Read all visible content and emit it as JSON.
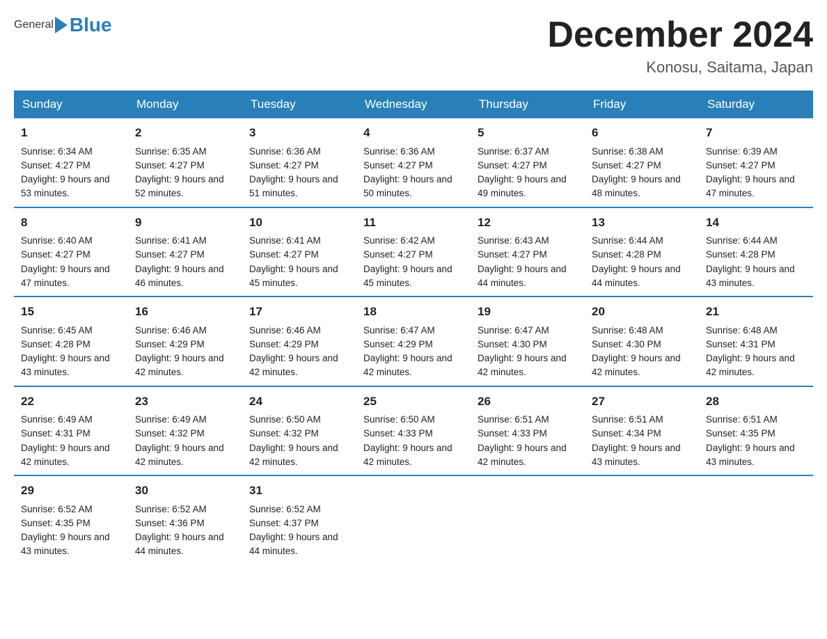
{
  "header": {
    "logo_general": "General",
    "logo_blue": "Blue",
    "month_title": "December 2024",
    "location": "Konosu, Saitama, Japan"
  },
  "days_of_week": [
    "Sunday",
    "Monday",
    "Tuesday",
    "Wednesday",
    "Thursday",
    "Friday",
    "Saturday"
  ],
  "weeks": [
    [
      {
        "day": "1",
        "sunrise": "6:34 AM",
        "sunset": "4:27 PM",
        "daylight": "9 hours and 53 minutes."
      },
      {
        "day": "2",
        "sunrise": "6:35 AM",
        "sunset": "4:27 PM",
        "daylight": "9 hours and 52 minutes."
      },
      {
        "day": "3",
        "sunrise": "6:36 AM",
        "sunset": "4:27 PM",
        "daylight": "9 hours and 51 minutes."
      },
      {
        "day": "4",
        "sunrise": "6:36 AM",
        "sunset": "4:27 PM",
        "daylight": "9 hours and 50 minutes."
      },
      {
        "day": "5",
        "sunrise": "6:37 AM",
        "sunset": "4:27 PM",
        "daylight": "9 hours and 49 minutes."
      },
      {
        "day": "6",
        "sunrise": "6:38 AM",
        "sunset": "4:27 PM",
        "daylight": "9 hours and 48 minutes."
      },
      {
        "day": "7",
        "sunrise": "6:39 AM",
        "sunset": "4:27 PM",
        "daylight": "9 hours and 47 minutes."
      }
    ],
    [
      {
        "day": "8",
        "sunrise": "6:40 AM",
        "sunset": "4:27 PM",
        "daylight": "9 hours and 47 minutes."
      },
      {
        "day": "9",
        "sunrise": "6:41 AM",
        "sunset": "4:27 PM",
        "daylight": "9 hours and 46 minutes."
      },
      {
        "day": "10",
        "sunrise": "6:41 AM",
        "sunset": "4:27 PM",
        "daylight": "9 hours and 45 minutes."
      },
      {
        "day": "11",
        "sunrise": "6:42 AM",
        "sunset": "4:27 PM",
        "daylight": "9 hours and 45 minutes."
      },
      {
        "day": "12",
        "sunrise": "6:43 AM",
        "sunset": "4:27 PM",
        "daylight": "9 hours and 44 minutes."
      },
      {
        "day": "13",
        "sunrise": "6:44 AM",
        "sunset": "4:28 PM",
        "daylight": "9 hours and 44 minutes."
      },
      {
        "day": "14",
        "sunrise": "6:44 AM",
        "sunset": "4:28 PM",
        "daylight": "9 hours and 43 minutes."
      }
    ],
    [
      {
        "day": "15",
        "sunrise": "6:45 AM",
        "sunset": "4:28 PM",
        "daylight": "9 hours and 43 minutes."
      },
      {
        "day": "16",
        "sunrise": "6:46 AM",
        "sunset": "4:29 PM",
        "daylight": "9 hours and 42 minutes."
      },
      {
        "day": "17",
        "sunrise": "6:46 AM",
        "sunset": "4:29 PM",
        "daylight": "9 hours and 42 minutes."
      },
      {
        "day": "18",
        "sunrise": "6:47 AM",
        "sunset": "4:29 PM",
        "daylight": "9 hours and 42 minutes."
      },
      {
        "day": "19",
        "sunrise": "6:47 AM",
        "sunset": "4:30 PM",
        "daylight": "9 hours and 42 minutes."
      },
      {
        "day": "20",
        "sunrise": "6:48 AM",
        "sunset": "4:30 PM",
        "daylight": "9 hours and 42 minutes."
      },
      {
        "day": "21",
        "sunrise": "6:48 AM",
        "sunset": "4:31 PM",
        "daylight": "9 hours and 42 minutes."
      }
    ],
    [
      {
        "day": "22",
        "sunrise": "6:49 AM",
        "sunset": "4:31 PM",
        "daylight": "9 hours and 42 minutes."
      },
      {
        "day": "23",
        "sunrise": "6:49 AM",
        "sunset": "4:32 PM",
        "daylight": "9 hours and 42 minutes."
      },
      {
        "day": "24",
        "sunrise": "6:50 AM",
        "sunset": "4:32 PM",
        "daylight": "9 hours and 42 minutes."
      },
      {
        "day": "25",
        "sunrise": "6:50 AM",
        "sunset": "4:33 PM",
        "daylight": "9 hours and 42 minutes."
      },
      {
        "day": "26",
        "sunrise": "6:51 AM",
        "sunset": "4:33 PM",
        "daylight": "9 hours and 42 minutes."
      },
      {
        "day": "27",
        "sunrise": "6:51 AM",
        "sunset": "4:34 PM",
        "daylight": "9 hours and 43 minutes."
      },
      {
        "day": "28",
        "sunrise": "6:51 AM",
        "sunset": "4:35 PM",
        "daylight": "9 hours and 43 minutes."
      }
    ],
    [
      {
        "day": "29",
        "sunrise": "6:52 AM",
        "sunset": "4:35 PM",
        "daylight": "9 hours and 43 minutes."
      },
      {
        "day": "30",
        "sunrise": "6:52 AM",
        "sunset": "4:36 PM",
        "daylight": "9 hours and 44 minutes."
      },
      {
        "day": "31",
        "sunrise": "6:52 AM",
        "sunset": "4:37 PM",
        "daylight": "9 hours and 44 minutes."
      },
      null,
      null,
      null,
      null
    ]
  ],
  "labels": {
    "sunrise": "Sunrise:",
    "sunset": "Sunset:",
    "daylight": "Daylight:"
  }
}
